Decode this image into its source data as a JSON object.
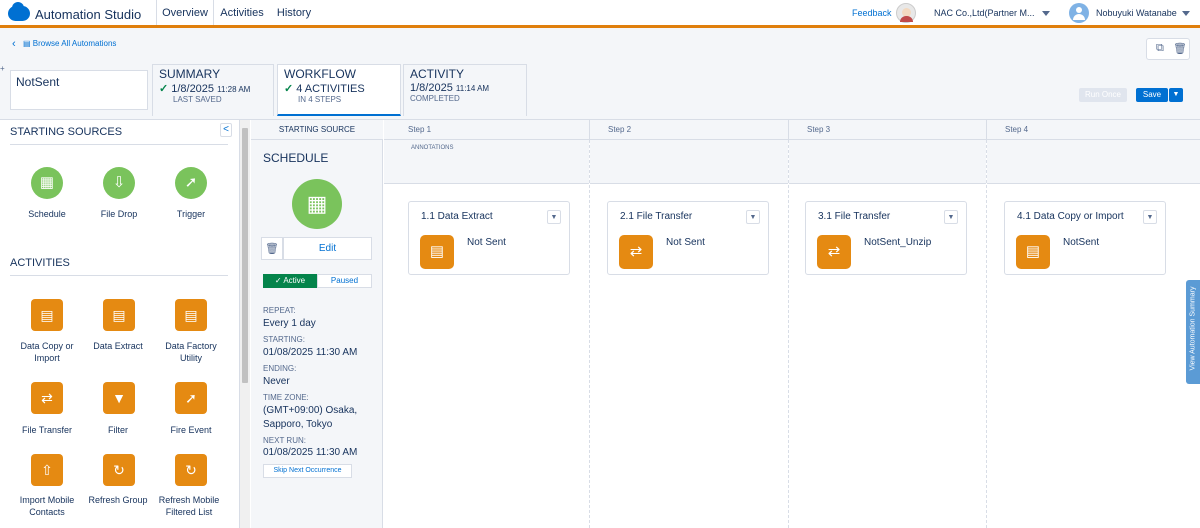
{
  "app": {
    "title": "Automation Studio"
  },
  "top_tabs": [
    {
      "label": "Overview",
      "active": true
    },
    {
      "label": "Activities",
      "active": false
    },
    {
      "label": "History",
      "active": false
    }
  ],
  "header": {
    "feedback": "Feedback",
    "org": "NAC Co.,Ltd(Partner M...",
    "user": "Nobuyuki Watanabe"
  },
  "breadcrumb": "Browse All Automations",
  "automation_name": "NotSent",
  "summary_tabs": [
    {
      "title": "SUMMARY",
      "value": "1/8/2025",
      "time": "11:28 AM",
      "sub": "LAST SAVED",
      "check": true
    },
    {
      "title": "WORKFLOW",
      "value": "4 ACTIVITIES",
      "time": "",
      "sub": "IN 4 STEPS",
      "check": true
    },
    {
      "title": "ACTIVITY",
      "value": "1/8/2025",
      "time": "11:14 AM",
      "sub": "COMPLETED",
      "check": false
    }
  ],
  "buttons": {
    "run_once": "Run Once",
    "save": "Save",
    "collapse": "<"
  },
  "left_panel": {
    "starting_sources_title": "STARTING SOURCES",
    "sources": [
      {
        "label": "Schedule",
        "icon": "calendar-icon"
      },
      {
        "label": "File Drop",
        "icon": "file-drop-icon"
      },
      {
        "label": "Trigger",
        "icon": "lightning-icon"
      }
    ],
    "activities_title": "ACTIVITIES",
    "activities": [
      {
        "label": "Data Copy or Import",
        "icon": "data-copy-icon"
      },
      {
        "label": "Data Extract",
        "icon": "data-extract-icon"
      },
      {
        "label": "Data Factory Utility",
        "icon": "data-factory-icon"
      },
      {
        "label": "File Transfer",
        "icon": "file-transfer-icon"
      },
      {
        "label": "Filter",
        "icon": "filter-icon"
      },
      {
        "label": "Fire Event",
        "icon": "lightning-icon"
      },
      {
        "label": "Import Mobile Contacts",
        "icon": "import-mobile-icon"
      },
      {
        "label": "Refresh Group",
        "icon": "refresh-group-icon"
      },
      {
        "label": "Refresh Mobile Filtered List",
        "icon": "refresh-list-icon"
      }
    ]
  },
  "schedule": {
    "col_header": "STARTING SOURCE",
    "title": "SCHEDULE",
    "edit": "Edit",
    "active": "Active",
    "paused": "Paused",
    "repeat_k": "REPEAT:",
    "repeat_v": "Every 1 day",
    "starting_k": "STARTING:",
    "starting_v": "01/08/2025 11:30 AM",
    "ending_k": "ENDING:",
    "ending_v": "Never",
    "tz_k": "TIME ZONE:",
    "tz_v1": "(GMT+09:00) Osaka,",
    "tz_v2": "Sapporo, Tokyo",
    "next_k": "NEXT RUN:",
    "next_v": "01/08/2025 11:30 AM",
    "skip": "Skip Next Occurrence"
  },
  "workflow": {
    "annotations": "ANNOTATIONS",
    "steps": [
      {
        "label": "Step 1",
        "card_title": "1.1 Data Extract",
        "card_name": "Not Sent",
        "icon": "data-extract-icon"
      },
      {
        "label": "Step 2",
        "card_title": "2.1 File Transfer",
        "card_name": "Not Sent",
        "icon": "file-transfer-icon"
      },
      {
        "label": "Step 3",
        "card_title": "3.1 File Transfer",
        "card_name": "NotSent_Unzip",
        "icon": "file-transfer-icon"
      },
      {
        "label": "Step 4",
        "card_title": "4.1 Data Copy or Import",
        "card_name": "NotSent",
        "icon": "data-copy-icon"
      }
    ]
  },
  "side_tab": "View Automation Summary",
  "colors": {
    "accent": "#e07f0c",
    "brand": "#0070d2",
    "activity": "#e58a12",
    "source": "#7ac35c",
    "active_green": "#04844b"
  }
}
